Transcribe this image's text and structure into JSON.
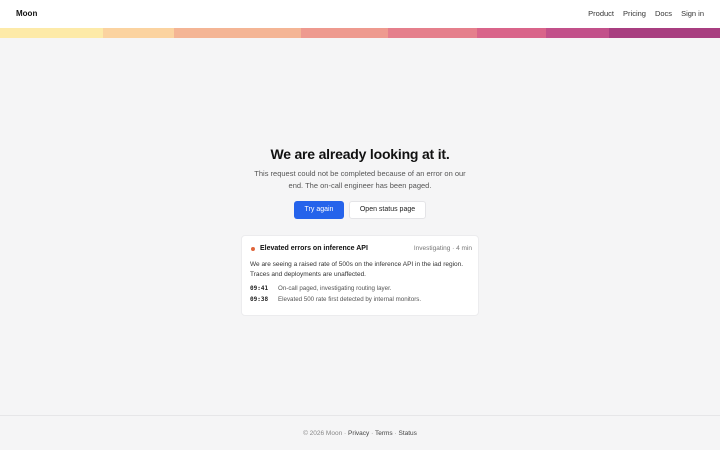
{
  "header": {
    "brand": "Moon",
    "nav": {
      "product": "Product",
      "pricing": "Pricing",
      "docs": "Docs",
      "signin": "Sign in"
    }
  },
  "strip_colors": [
    "#fdeaa8",
    "#fbd3a0",
    "#f4b595",
    "#ee9a8f",
    "#e57f8c",
    "#d9648a",
    "#c2508a",
    "#a83e80"
  ],
  "main": {
    "title": "We are already looking at it.",
    "description": "This request could not be completed because of an error on our end. The on-call engineer has been paged.",
    "retry_label": "Try again",
    "status_label": "Open status page"
  },
  "incident": {
    "title": "Elevated errors on inference API",
    "meta": "Investigating · 4 min",
    "body": "We are seeing a raised rate of 500s on the inference API in the iad region. Traces and deployments are unaffected.",
    "status_color": "#e0653b",
    "updates": [
      {
        "time": "09:41",
        "message": "On-call paged, investigating routing layer."
      },
      {
        "time": "09:38",
        "message": "Elevated 500 rate first detected by internal monitors."
      }
    ]
  },
  "footer": {
    "copyright": "© 2026 Moon",
    "sep": "·",
    "privacy": "Privacy",
    "terms": "Terms",
    "status": "Status"
  }
}
